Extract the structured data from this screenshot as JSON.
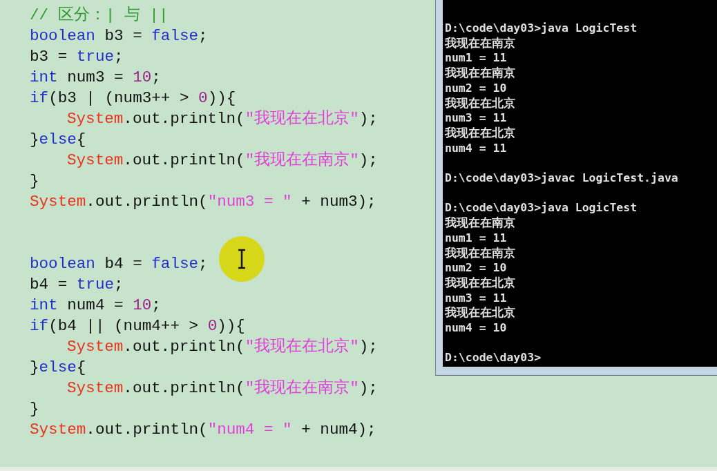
{
  "editor": {
    "blocks": [
      [
        {
          "indented": false,
          "tokens": [
            {
              "kind": "comment",
              "text": "// 区分：| 与 ||"
            }
          ]
        },
        {
          "indented": false,
          "tokens": [
            {
              "kind": "keyword",
              "text": "boolean"
            },
            {
              "kind": "plain",
              "text": " b3 = "
            },
            {
              "kind": "keyword",
              "text": "false"
            },
            {
              "kind": "plain",
              "text": ";"
            }
          ]
        },
        {
          "indented": false,
          "tokens": [
            {
              "kind": "plain",
              "text": "b3 = "
            },
            {
              "kind": "keyword",
              "text": "true"
            },
            {
              "kind": "plain",
              "text": ";"
            }
          ]
        },
        {
          "indented": false,
          "tokens": [
            {
              "kind": "keyword",
              "text": "int"
            },
            {
              "kind": "plain",
              "text": " num3 = "
            },
            {
              "kind": "number",
              "text": "10"
            },
            {
              "kind": "plain",
              "text": ";"
            }
          ]
        },
        {
          "indented": false,
          "tokens": [
            {
              "kind": "keyword",
              "text": "if"
            },
            {
              "kind": "plain",
              "text": "(b3 | (num3++ > "
            },
            {
              "kind": "number",
              "text": "0"
            },
            {
              "kind": "plain",
              "text": ")){"
            }
          ]
        },
        {
          "indented": true,
          "tokens": [
            {
              "kind": "class",
              "text": "System"
            },
            {
              "kind": "plain",
              "text": ".out.println("
            },
            {
              "kind": "string",
              "text": "\"我现在在北京\""
            },
            {
              "kind": "plain",
              "text": ");"
            }
          ]
        },
        {
          "indented": false,
          "tokens": [
            {
              "kind": "plain",
              "text": "}"
            },
            {
              "kind": "keyword",
              "text": "else"
            },
            {
              "kind": "plain",
              "text": "{"
            }
          ]
        },
        {
          "indented": true,
          "tokens": [
            {
              "kind": "class",
              "text": "System"
            },
            {
              "kind": "plain",
              "text": ".out.println("
            },
            {
              "kind": "string",
              "text": "\"我现在在南京\""
            },
            {
              "kind": "plain",
              "text": ");"
            }
          ]
        },
        {
          "indented": false,
          "tokens": [
            {
              "kind": "plain",
              "text": "}"
            }
          ]
        },
        {
          "indented": false,
          "tokens": [
            {
              "kind": "class",
              "text": "System"
            },
            {
              "kind": "plain",
              "text": ".out.println("
            },
            {
              "kind": "string",
              "text": "\"num3 = \""
            },
            {
              "kind": "plain",
              "text": " + num3);"
            }
          ]
        }
      ],
      [
        {
          "indented": false,
          "tokens": [
            {
              "kind": "keyword",
              "text": "boolean"
            },
            {
              "kind": "plain",
              "text": " b4 = "
            },
            {
              "kind": "keyword",
              "text": "false"
            },
            {
              "kind": "plain",
              "text": ";"
            }
          ]
        },
        {
          "indented": false,
          "tokens": [
            {
              "kind": "plain",
              "text": "b4 = "
            },
            {
              "kind": "keyword",
              "text": "true"
            },
            {
              "kind": "plain",
              "text": ";"
            }
          ]
        },
        {
          "indented": false,
          "tokens": [
            {
              "kind": "keyword",
              "text": "int"
            },
            {
              "kind": "plain",
              "text": " num4 = "
            },
            {
              "kind": "number",
              "text": "10"
            },
            {
              "kind": "plain",
              "text": ";"
            }
          ]
        },
        {
          "indented": false,
          "tokens": [
            {
              "kind": "keyword",
              "text": "if"
            },
            {
              "kind": "plain",
              "text": "(b4 || (num4++ > "
            },
            {
              "kind": "number",
              "text": "0"
            },
            {
              "kind": "plain",
              "text": ")){"
            }
          ]
        },
        {
          "indented": true,
          "tokens": [
            {
              "kind": "class",
              "text": "System"
            },
            {
              "kind": "plain",
              "text": ".out.println("
            },
            {
              "kind": "string",
              "text": "\"我现在在北京\""
            },
            {
              "kind": "plain",
              "text": ");"
            }
          ]
        },
        {
          "indented": false,
          "tokens": [
            {
              "kind": "plain",
              "text": "}"
            },
            {
              "kind": "keyword",
              "text": "else"
            },
            {
              "kind": "plain",
              "text": "{"
            }
          ]
        },
        {
          "indented": true,
          "tokens": [
            {
              "kind": "class",
              "text": "System"
            },
            {
              "kind": "plain",
              "text": ".out.println("
            },
            {
              "kind": "string",
              "text": "\"我现在在南京\""
            },
            {
              "kind": "plain",
              "text": ");"
            }
          ]
        },
        {
          "indented": false,
          "tokens": [
            {
              "kind": "plain",
              "text": "}"
            }
          ]
        },
        {
          "indented": false,
          "tokens": [
            {
              "kind": "class",
              "text": "System"
            },
            {
              "kind": "plain",
              "text": ".out.println("
            },
            {
              "kind": "string",
              "text": "\"num4 = \""
            },
            {
              "kind": "plain",
              "text": " + num4);"
            }
          ]
        }
      ]
    ]
  },
  "console": {
    "blocks": [
      [
        "D:\\code\\day03>java LogicTest",
        "我现在在南京",
        "num1 = 11",
        "我现在在南京",
        "num2 = 10",
        "我现在在北京",
        "num3 = 11",
        "我现在在北京",
        "num4 = 11"
      ],
      [
        "D:\\code\\day03>javac LogicTest.java"
      ],
      [
        "D:\\code\\day03>java LogicTest",
        "我现在在南京",
        "num1 = 11",
        "我现在在南京",
        "num2 = 10",
        "我现在在北京",
        "num3 = 11",
        "我现在在北京",
        "num4 = 10"
      ],
      [
        "D:\\code\\day03>"
      ]
    ]
  }
}
